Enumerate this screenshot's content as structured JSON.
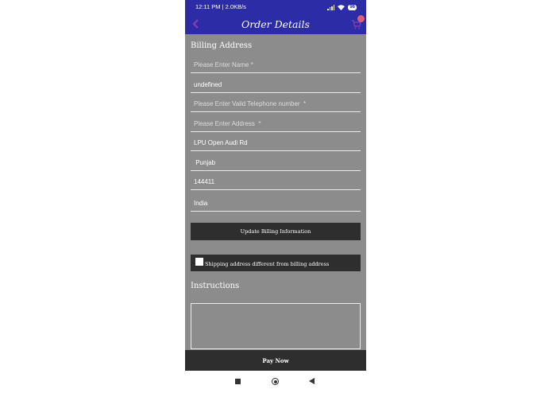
{
  "status_bar": {
    "time": "12:11 PM | 2.0KB/s",
    "battery": "96"
  },
  "app_bar": {
    "title": "Order Details",
    "back_icon": "back-arrow-icon",
    "cart_icon": "cart-icon",
    "accent_color": "#2c2ca6"
  },
  "billing": {
    "title": "Billing Address",
    "fields": [
      {
        "name": "name-field",
        "value": "",
        "placeholder": "Please Enter Name *"
      },
      {
        "name": "field-2",
        "value": "undefined",
        "placeholder": ""
      },
      {
        "name": "telephone-field",
        "value": "",
        "placeholder": "Please Enter Valid Telephone number  *"
      },
      {
        "name": "address-field",
        "value": "",
        "placeholder": "Please Enter Address  *"
      },
      {
        "name": "street-field",
        "value": "LPU Open Audi Rd",
        "placeholder": ""
      },
      {
        "name": "state-field",
        "value": " Punjab",
        "placeholder": ""
      },
      {
        "name": "postal-code-field",
        "value": "144411",
        "placeholder": ""
      },
      {
        "name": "country-field",
        "value": "India",
        "placeholder": ""
      }
    ],
    "update_button": "Update Billing Information"
  },
  "shipping": {
    "checkbox_label": "Shipping address different from billing address",
    "checked": false
  },
  "instructions": {
    "title": "Instructions",
    "value": ""
  },
  "pay_button": "Pay Now"
}
